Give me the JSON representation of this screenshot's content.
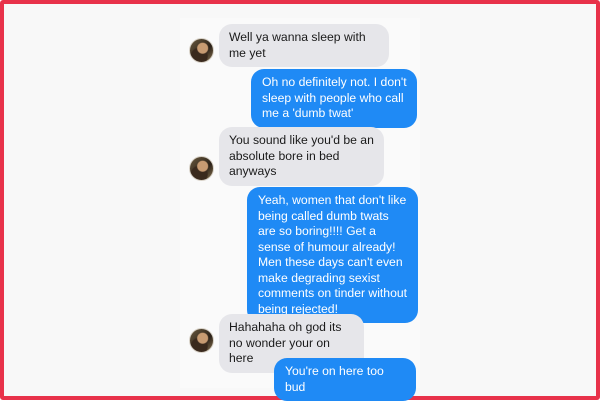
{
  "conversation": {
    "messages": [
      {
        "from": "them",
        "text": "Well ya wanna sleep with me yet"
      },
      {
        "from": "me",
        "text": "Oh no definitely not. I don't sleep with people who call me a 'dumb twat'"
      },
      {
        "from": "them",
        "text": "You sound like you'd be an absolute bore in bed anyways"
      },
      {
        "from": "me",
        "text": "Yeah, women that don't like being called dumb twats are so boring!!!! Get a sense of humour already! Men these days can't even make degrading sexist comments on tinder without being rejected!"
      },
      {
        "from": "them",
        "text": "Hahahaha oh god its no wonder your on here"
      },
      {
        "from": "me",
        "text": "You're on here too bud"
      }
    ]
  },
  "colors": {
    "frame_border": "#e8324a",
    "received_bubble": "#e6e6ea",
    "sent_bubble": "#1f8af5"
  },
  "icons": {
    "avatar": "contact-avatar-icon"
  }
}
